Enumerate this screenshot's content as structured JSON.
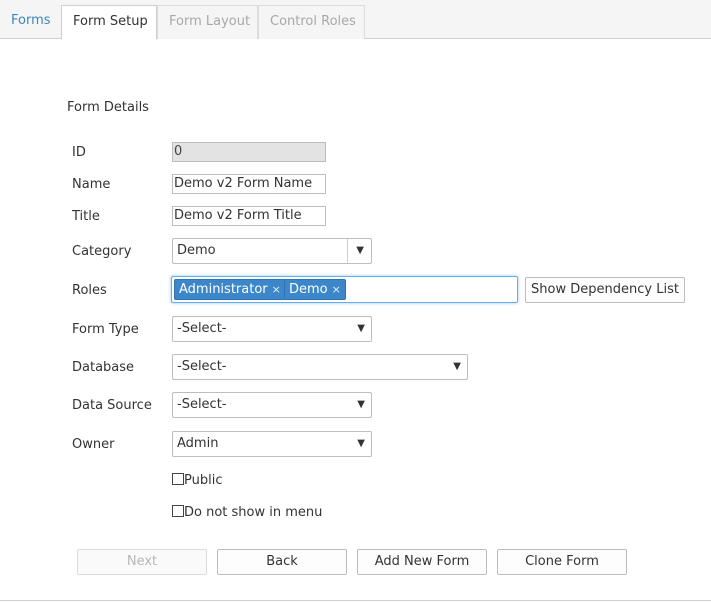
{
  "tabs": {
    "forms": "Forms",
    "form_setup": "Form Setup",
    "form_layout": "Form Layout",
    "control_roles": "Control Roles"
  },
  "section_title": "Form Details",
  "fields": {
    "id": {
      "label": "ID",
      "value": "0"
    },
    "name": {
      "label": "Name",
      "value": "Demo v2 Form Name"
    },
    "title": {
      "label": "Title",
      "value": "Demo v2 Form Title"
    },
    "category": {
      "label": "Category",
      "value": "Demo"
    },
    "roles": {
      "label": "Roles",
      "chips": [
        "Administrator",
        "Demo"
      ],
      "remove_glyph": "×"
    },
    "form_type": {
      "label": "Form Type",
      "value": "-Select-"
    },
    "database": {
      "label": "Database",
      "value": "-Select-"
    },
    "data_source": {
      "label": "Data Source",
      "value": "-Select-"
    },
    "owner": {
      "label": "Owner",
      "value": "Admin"
    }
  },
  "dropdown_glyph": "▼",
  "show_dependency_button": "Show Dependency List",
  "checkboxes": {
    "public": {
      "label": "Public",
      "checked": false
    },
    "hide_in_menu": {
      "label": "Do not show in menu",
      "checked": false
    }
  },
  "actions": {
    "next": "Next",
    "back": "Back",
    "add_new_form": "Add New Form",
    "clone_form": "Clone Form"
  },
  "colors": {
    "accent": "#3b87c9",
    "link": "#3a87c6",
    "focus_border": "#66afe9"
  }
}
